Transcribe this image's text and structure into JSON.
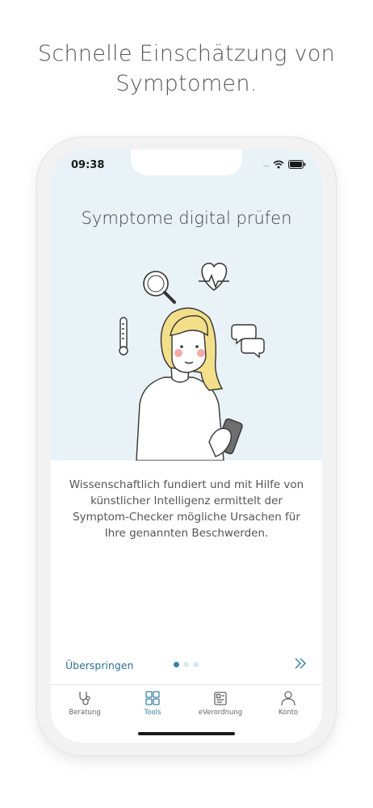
{
  "headline": "Schnelle Einschätzung von Symptomen.",
  "status_bar": {
    "time": "09:38",
    "signal": "....",
    "icons": [
      "wifi-icon",
      "battery-icon"
    ]
  },
  "screen": {
    "title": "Symptome digital prüfen",
    "description": "Wissenschaftlich fundiert und mit Hilfe von künstlicher Intelligenz ermittelt der Symptom-Checker mögliche Ursachen für Ihre genannten Beschwerden.",
    "skip_label": "Überspringen",
    "pager": {
      "total": 3,
      "current": 1
    },
    "next_icon": "double-chevron-right-icon"
  },
  "tabbar": {
    "items": [
      {
        "label": "Beratung",
        "icon": "stethoscope-icon",
        "active": false
      },
      {
        "label": "Tools",
        "icon": "grid-icon",
        "active": true
      },
      {
        "label": "eVerordnung",
        "icon": "prescription-icon",
        "active": false
      },
      {
        "label": "Konto",
        "icon": "person-icon",
        "active": false
      }
    ]
  },
  "colors": {
    "hero_bg": "#e9f2f6",
    "accent": "#3b82a6",
    "skip": "#2f6f8f",
    "hair": "#f3df8a"
  }
}
